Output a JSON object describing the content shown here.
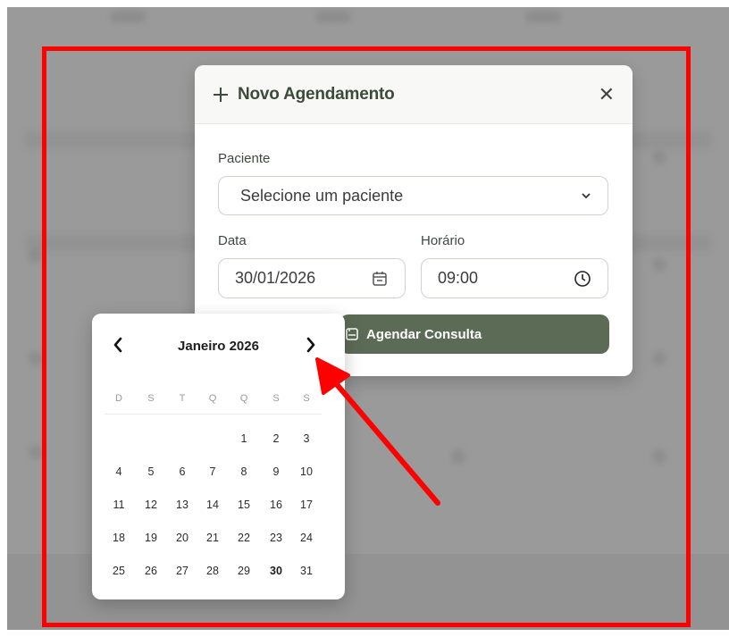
{
  "modal": {
    "title": "Novo Agendamento",
    "patient_label": "Paciente",
    "patient_placeholder": "Selecione um paciente",
    "date_label": "Data",
    "date_value": "30/01/2026",
    "time_label": "Horário",
    "time_value": "09:00",
    "submit_label": "Agendar Consulta"
  },
  "datepicker": {
    "month_title": "Janeiro 2026",
    "weekdays": [
      "D",
      "S",
      "T",
      "Q",
      "Q",
      "S",
      "S"
    ],
    "first_weekday_index": 4,
    "days_in_month": 31,
    "selected_day": 30
  },
  "colors": {
    "accent": "#5c6b56",
    "annotation": "#ff0000"
  }
}
